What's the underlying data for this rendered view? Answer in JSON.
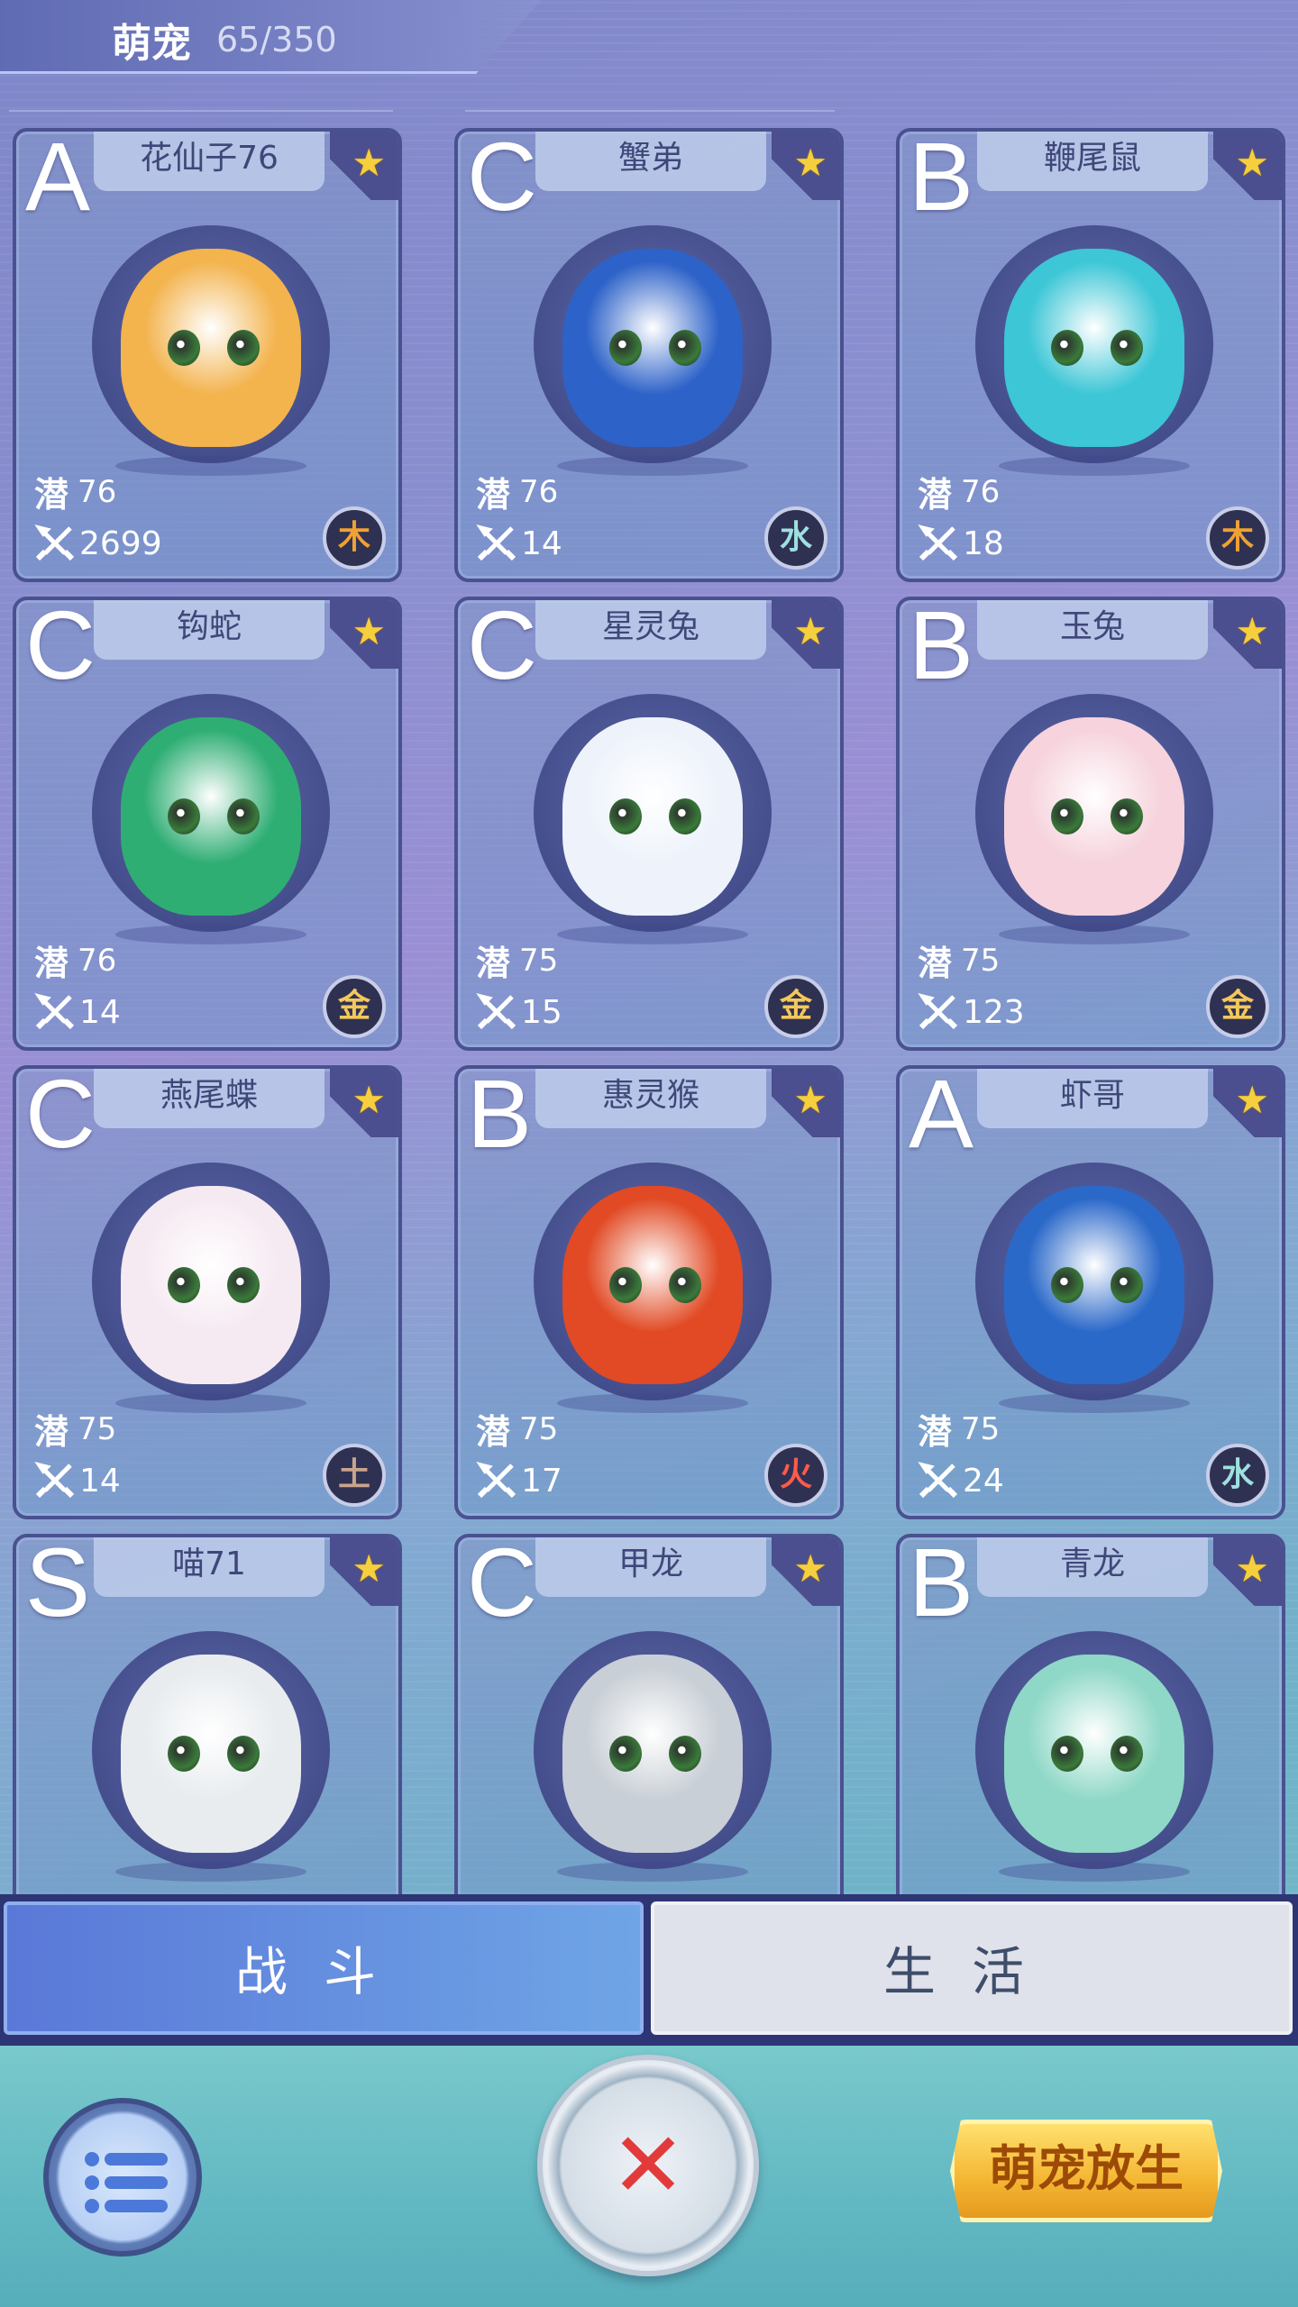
{
  "header": {
    "title": "萌宠",
    "count": "65/350"
  },
  "cards": [
    {
      "grade": "A",
      "name": "花仙子76",
      "potential": "76",
      "power": "2699",
      "element": "木",
      "element_color": "#f0a133",
      "portrait_color": "#f3b34d"
    },
    {
      "grade": "C",
      "name": "蟹弟",
      "potential": "76",
      "power": "14",
      "element": "水",
      "element_color": "#9fe0e0",
      "portrait_color": "#2d62c8"
    },
    {
      "grade": "B",
      "name": "鞭尾鼠",
      "potential": "76",
      "power": "18",
      "element": "木",
      "element_color": "#f0a133",
      "portrait_color": "#3cc6d6"
    },
    {
      "grade": "C",
      "name": "钩蛇",
      "potential": "76",
      "power": "14",
      "element": "金",
      "element_color": "#f3c85a",
      "portrait_color": "#2fae74"
    },
    {
      "grade": "C",
      "name": "星灵兔",
      "potential": "75",
      "power": "15",
      "element": "金",
      "element_color": "#f3c85a",
      "portrait_color": "#eef3fb"
    },
    {
      "grade": "B",
      "name": "玉兔",
      "potential": "75",
      "power": "123",
      "element": "金",
      "element_color": "#f3c85a",
      "portrait_color": "#f6d3dd"
    },
    {
      "grade": "C",
      "name": "燕尾蝶",
      "potential": "75",
      "power": "14",
      "element": "土",
      "element_color": "#c9a48c",
      "portrait_color": "#f6eaf2"
    },
    {
      "grade": "B",
      "name": "惠灵猴",
      "potential": "75",
      "power": "17",
      "element": "火",
      "element_color": "#ff5a4a",
      "portrait_color": "#e14a24"
    },
    {
      "grade": "A",
      "name": "虾哥",
      "potential": "75",
      "power": "24",
      "element": "水",
      "element_color": "#9fe0e0",
      "portrait_color": "#2b69c9"
    },
    {
      "grade": "S",
      "name": "喵71",
      "potential": "",
      "power": "",
      "element": "",
      "element_color": "#ffffff",
      "portrait_color": "#e8ecef"
    },
    {
      "grade": "C",
      "name": "甲龙",
      "potential": "",
      "power": "",
      "element": "",
      "element_color": "#ffffff",
      "portrait_color": "#c9cfd6"
    },
    {
      "grade": "B",
      "name": "青龙",
      "potential": "",
      "power": "",
      "element": "",
      "element_color": "#ffffff",
      "portrait_color": "#8fd8c7"
    }
  ],
  "labels": {
    "potential_icon": "潜"
  },
  "tabs": {
    "battle": "战斗",
    "life": "生活"
  },
  "bottom": {
    "release_label": "萌宠放生",
    "release_sub": ""
  },
  "icons": {
    "star": "star-icon",
    "menu": "menu-list-icon",
    "close": "close-icon",
    "power": "crossed-swords-icon"
  }
}
